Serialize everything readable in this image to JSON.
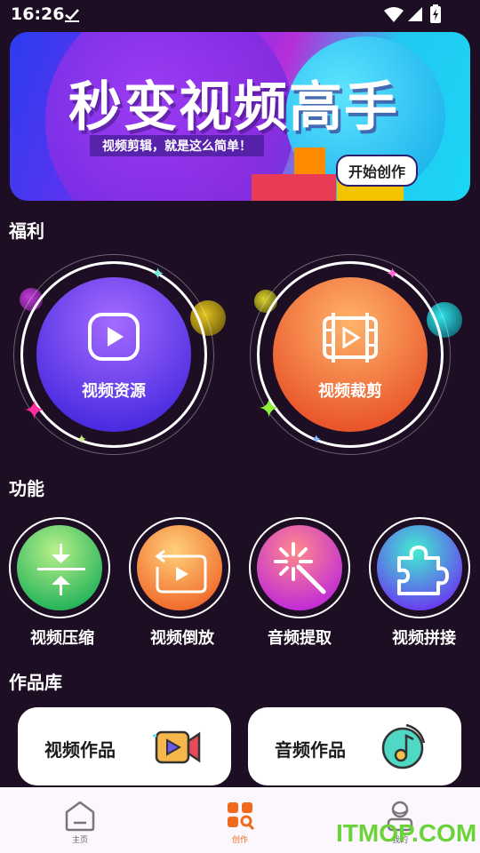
{
  "status_bar": {
    "time": "16:26"
  },
  "banner": {
    "title": "秒变视频高手",
    "subtitle": "视频剪辑，就是这么简单！",
    "button_label": "开始创作"
  },
  "sections": {
    "welfare": "福利",
    "functions": "功能",
    "works": "作品库"
  },
  "welfare_items": [
    {
      "label": "视频资源",
      "icon": "play-icon"
    },
    {
      "label": "视频裁剪",
      "icon": "film-crop-icon"
    }
  ],
  "functions": [
    {
      "label": "视频压缩",
      "icon": "compress-icon"
    },
    {
      "label": "视频倒放",
      "icon": "reverse-play-icon"
    },
    {
      "label": "音频提取",
      "icon": "magic-wand-icon"
    },
    {
      "label": "视频拼接",
      "icon": "puzzle-icon"
    }
  ],
  "works_cards": [
    {
      "label": "视频作品",
      "icon": "video-camera-icon"
    },
    {
      "label": "音频作品",
      "icon": "music-note-icon"
    }
  ],
  "bottom_nav": [
    {
      "label": "主页",
      "icon": "home-icon",
      "active": false
    },
    {
      "label": "创作",
      "icon": "create-icon",
      "active": true
    },
    {
      "label": "我的",
      "icon": "profile-icon",
      "active": false
    }
  ],
  "watermark": "ITMOP.COM",
  "colors": {
    "accent": "#f06a1e",
    "background": "#1e0e24"
  }
}
